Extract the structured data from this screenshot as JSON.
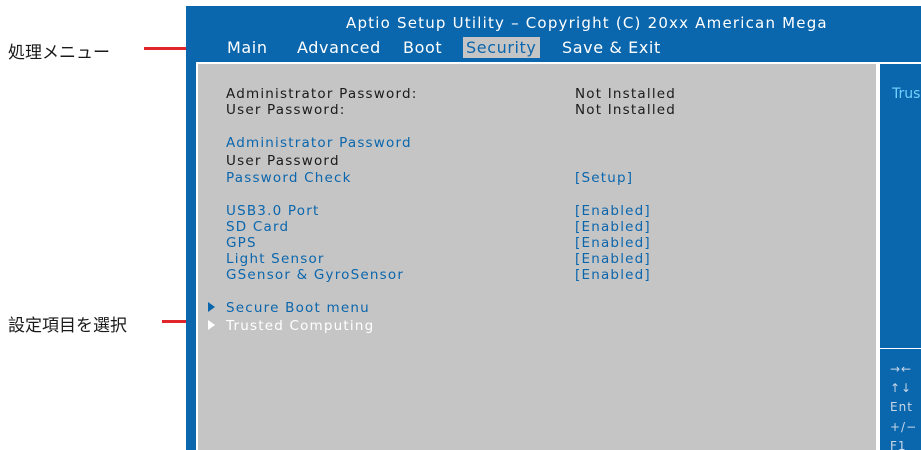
{
  "annotations": {
    "menu_label": "処理メニュー",
    "select_label": "設定項目を選択",
    "line_color": "#e0252b"
  },
  "header": {
    "title": "Aptio Setup Utility – Copyright (C) 20xx American Mega"
  },
  "menu": {
    "main": "Main",
    "advanced": "Advanced",
    "boot": "Boot",
    "security": "Security",
    "save_exit": "Save & Exit",
    "active": "Security"
  },
  "info": {
    "admin_label": "Administrator Password:",
    "admin_value": "Not Installed",
    "user_label": "User Password:",
    "user_value": "Not Installed"
  },
  "settings": {
    "admin_password": "Administrator Password",
    "user_password": "User Password",
    "password_check": "Password Check",
    "password_check_value": "[Setup]",
    "usb_port": "USB3.0 Port",
    "usb_port_value": "[Enabled]",
    "sd_card": "SD Card",
    "sd_card_value": "[Enabled]",
    "gps": "GPS",
    "gps_value": "[Enabled]",
    "light_sensor": "Light Sensor",
    "light_sensor_value": "[Enabled]",
    "gsensor": "GSensor & GyroSensor",
    "gsensor_value": "[Enabled]",
    "secure_boot_menu": "Secure Boot menu",
    "trusted_computing": "Trusted Computing"
  },
  "help_panel": {
    "title": "Trus",
    "keys": [
      "→←",
      "↑↓",
      "Ent",
      "+/−",
      "F1"
    ]
  },
  "colors": {
    "bios_blue": "#0a66ad",
    "panel_gray": "#c5c5c5",
    "highlight_white": "#ffffff"
  }
}
